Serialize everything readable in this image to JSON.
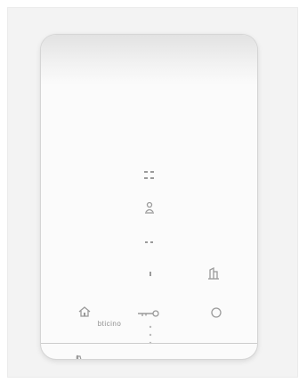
{
  "device": {
    "brand_label": "bticino",
    "icons": [
      "menu-grid-icon",
      "user-icon",
      "dots-icon",
      "small-dot-icon",
      "door-icon",
      "home-icon",
      "key-icon",
      "circle-icon",
      "phone-icon",
      "hangup-icon"
    ],
    "colors": {
      "background": "#ffffff",
      "frame": "#f3f3f3",
      "panel": "#fbfbfb",
      "icon": "#9a9a9a",
      "divider": "#cdcdcd"
    }
  }
}
